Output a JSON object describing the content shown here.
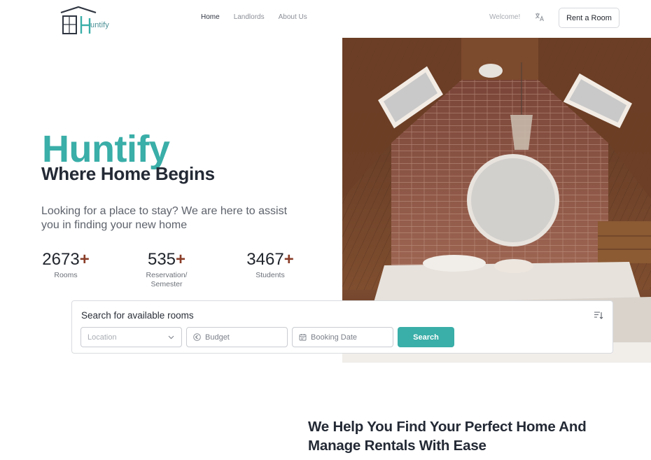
{
  "header": {
    "logo_text": "untify",
    "nav": [
      {
        "label": "Home",
        "active": true
      },
      {
        "label": "Landlords",
        "active": false
      },
      {
        "label": "About Us",
        "active": false
      }
    ],
    "welcome": "Welcome!",
    "language_icon": "translate-icon",
    "rent_button": "Rent a Room"
  },
  "hero": {
    "title": "Huntify",
    "subtitle": "Where Home Begins",
    "description": "Looking for a place to stay? We are here to assist you in finding your new home",
    "stats": [
      {
        "value": "2673",
        "suffix": "+",
        "label": "Rooms"
      },
      {
        "value": "535",
        "suffix": "+",
        "label": "Reservation/ Semester"
      },
      {
        "value": "3467",
        "suffix": "+",
        "label": "Students"
      }
    ],
    "image_alt": "attic bedroom with round window"
  },
  "search": {
    "title": "Search for available rooms",
    "location_placeholder": "Location",
    "budget_placeholder": "Budget",
    "date_placeholder": "Booking Date",
    "button": "Search"
  },
  "section": {
    "heading": "We Help You Find Your Perfect Home And Manage Rentals With Ease"
  },
  "colors": {
    "accent": "#3aaea8",
    "plus": "#8a3d28",
    "dark": "#242a35"
  }
}
